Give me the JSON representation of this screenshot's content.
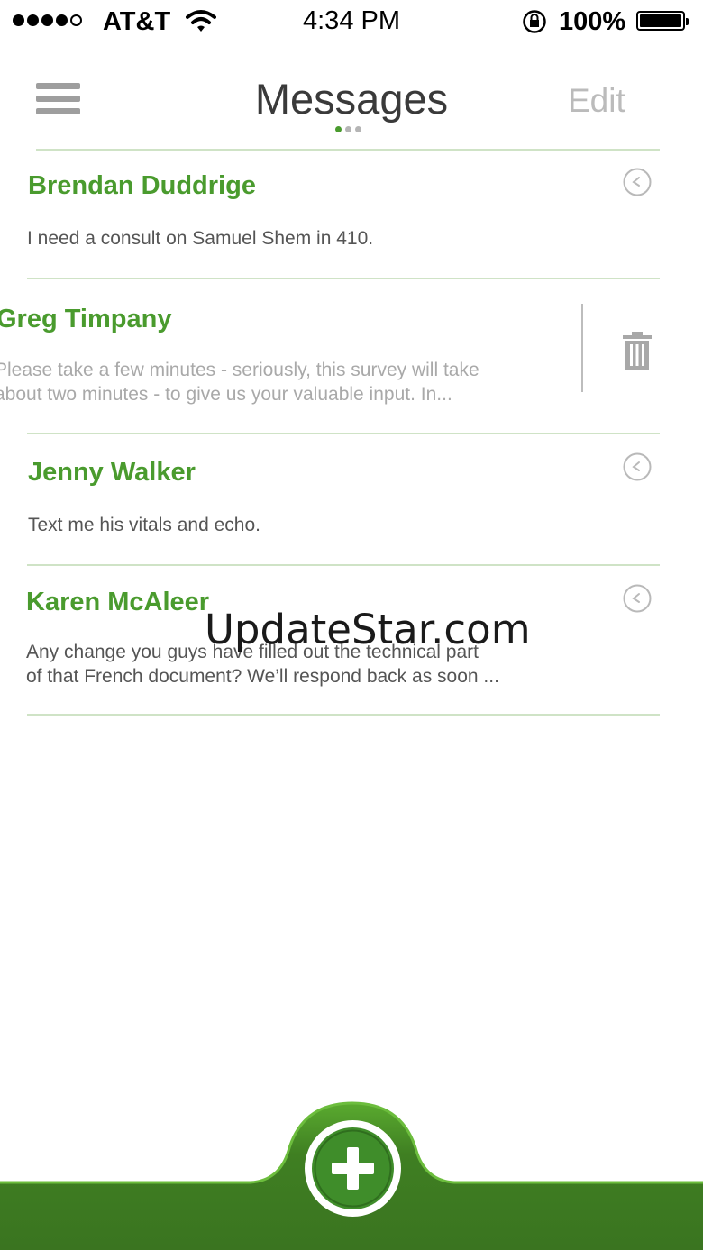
{
  "status_bar": {
    "carrier": "AT&T",
    "time": "4:34 PM",
    "battery": "100%",
    "signal_bars": 4,
    "signal_total": 5
  },
  "nav": {
    "title": "Messages",
    "edit_label": "Edit",
    "page_dots": 3,
    "active_dot": 0,
    "menu_icon": "hamburger-icon"
  },
  "messages": [
    {
      "name": "Brendan Duddrige",
      "preview_lines": [
        "I need a consult on Samuel Shem in 410."
      ],
      "icon": "clock-icon"
    },
    {
      "name": "Greg Timpany",
      "preview_lines": [
        "Please take a few minutes - seriously, this survey will take",
        "about two minutes - to give us your valuable input. In..."
      ],
      "icon": "trash-icon",
      "swiped": true
    },
    {
      "name": "Jenny Walker",
      "preview_lines": [
        "Text me his vitals and echo."
      ],
      "icon": "clock-icon"
    },
    {
      "name": "Karen McAleer",
      "preview_lines": [
        "Any change you guys have filled out the technical part",
        "of that French document? We’ll respond back as soon ..."
      ],
      "icon": "clock-icon"
    }
  ],
  "watermark": "UpdateStar.com",
  "bottom_bar": {
    "add_icon": "plus-icon"
  },
  "colors": {
    "accent": "#4a9b2e",
    "bar_dark": "#3f7f22",
    "bar_light": "#5aaa2f",
    "divider": "#cfe3c6"
  }
}
